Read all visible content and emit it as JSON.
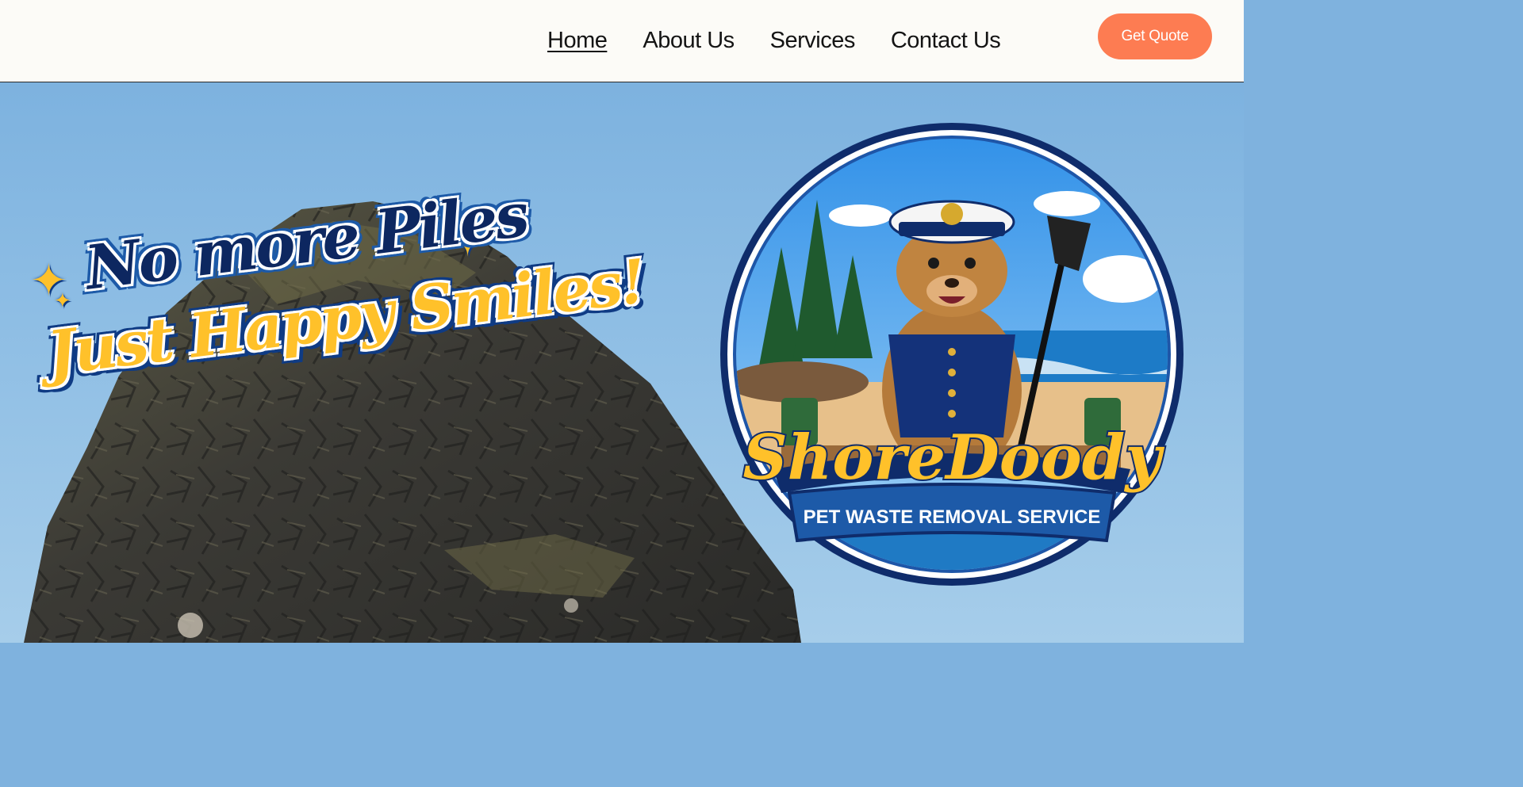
{
  "header": {
    "nav": [
      {
        "label": "Home",
        "active": true
      },
      {
        "label": "About Us",
        "active": false
      },
      {
        "label": "Services",
        "active": false
      },
      {
        "label": "Contact Us",
        "active": false
      }
    ],
    "cta_label": "Get Quote"
  },
  "hero": {
    "tagline_line1": "No more Piles",
    "tagline_line2": "Just Happy Smiles!"
  },
  "logo": {
    "brand_name": "ShoreDoody",
    "subtitle": "PET WASTE REMOVAL SERVICE"
  },
  "colors": {
    "header_bg": "#fcfbf7",
    "cta": "#fd7c52",
    "sky": "#7db2df",
    "navy": "#0d2760",
    "gold": "#ffc12a"
  }
}
